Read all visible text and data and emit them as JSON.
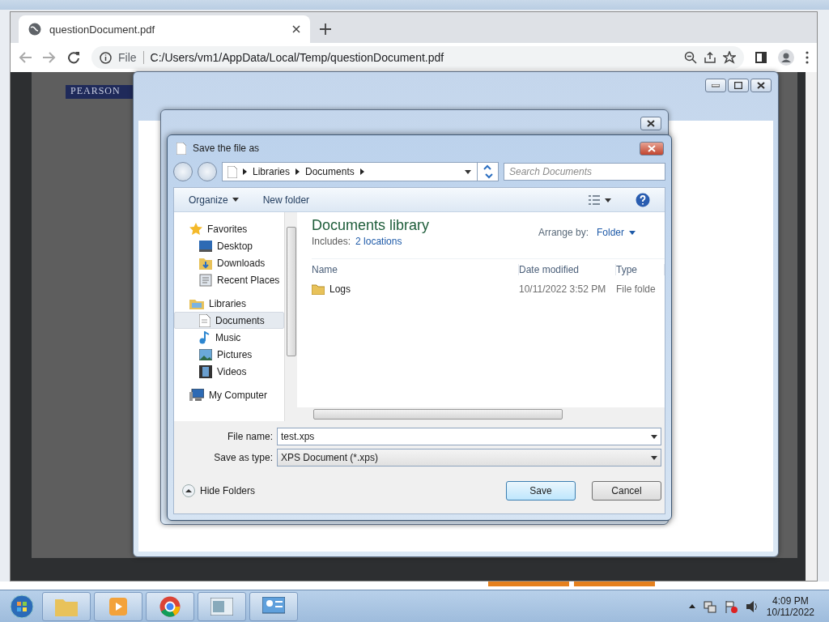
{
  "browser": {
    "tab": {
      "title": "questionDocument.pdf"
    },
    "address": {
      "scheme": "File",
      "url": "C:/Users/vm1/AppData/Local/Temp/questionDocument.pdf"
    }
  },
  "pdf": {
    "logo": "PEARSON"
  },
  "save_dialog": {
    "title": "Save the file as",
    "breadcrumb": [
      "Libraries",
      "Documents"
    ],
    "search": {
      "placeholder": "Search Documents"
    },
    "toolbar": {
      "organize": "Organize",
      "new_folder": "New folder"
    },
    "nav": [
      {
        "label": "Favorites",
        "selected": false,
        "children": [
          {
            "label": "Desktop",
            "selected": false
          },
          {
            "label": "Downloads",
            "selected": false
          },
          {
            "label": "Recent Places",
            "selected": false
          }
        ]
      },
      {
        "label": "Libraries",
        "selected": false,
        "children": [
          {
            "label": "Documents",
            "selected": true
          },
          {
            "label": "Music",
            "selected": false
          },
          {
            "label": "Pictures",
            "selected": false
          },
          {
            "label": "Videos",
            "selected": false
          }
        ]
      },
      {
        "label": "My Computer",
        "selected": false
      }
    ],
    "library": {
      "title": "Documents library",
      "includes_label": "Includes:",
      "includes_link": "2 locations",
      "arrange_label": "Arrange by:",
      "arrange_value": "Folder"
    },
    "columns": [
      "Name",
      "Date modified",
      "Type"
    ],
    "files": [
      {
        "name": "Logs",
        "date": "10/11/2022 3:52 PM",
        "type": "File folde"
      }
    ],
    "file_name": {
      "label": "File name:",
      "value": "test.xps"
    },
    "save_as_type": {
      "label": "Save as type:",
      "value": "XPS Document (*.xps)"
    },
    "hide_folders": "Hide Folders",
    "buttons": [
      {
        "label": "Save",
        "default": true
      },
      {
        "label": "Cancel",
        "default": false
      }
    ]
  },
  "taskbar": {
    "time": "4:09 PM",
    "date": "10/11/2022"
  }
}
